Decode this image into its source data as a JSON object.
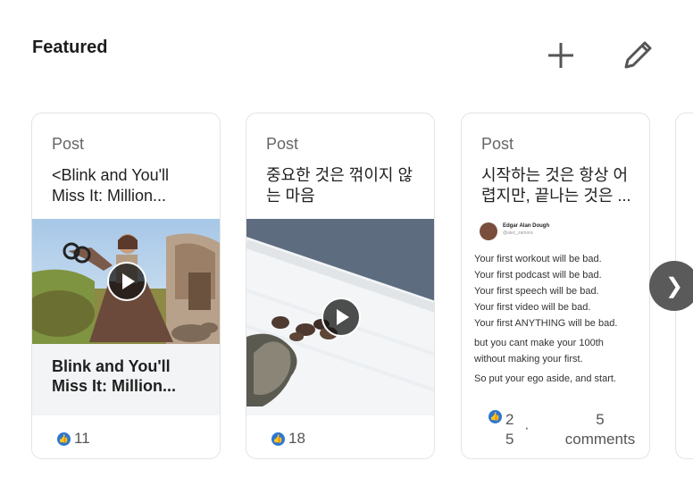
{
  "section": {
    "title": "Featured"
  },
  "actions": {
    "add": "add-icon",
    "edit": "pencil-icon"
  },
  "cards": [
    {
      "kind": "Post",
      "text": "<Blink and You'll Miss It: Million...",
      "caption": "Blink and You'll Miss It: Million...",
      "reactions": "11"
    },
    {
      "kind": "Post",
      "text": "중요한 것은 꺾이지 않는 마음",
      "reactions": "18"
    },
    {
      "kind": "Post",
      "text": " 시작하는 것은 항상 어렵지만, 끝나는 것은 ...",
      "tweet": {
        "author": "Edgar Alan Dough",
        "handle": "@alec_zamora",
        "lines": [
          "Your first workout will be bad.",
          "Your first podcast will be bad.",
          "Your first speech will be bad.",
          "Your first video will be bad.",
          "Your first ANYTHING will be bad.",
          "but you cant make your 100th",
          "without making your first.",
          "So put your ego aside, and start."
        ]
      },
      "reactions": "25",
      "separator": "·",
      "comments": "5 comments"
    }
  ],
  "navigation": {
    "next": "❯"
  },
  "colors": {
    "accent": "#2d77d0",
    "nav_button": "#5a5a5a"
  }
}
